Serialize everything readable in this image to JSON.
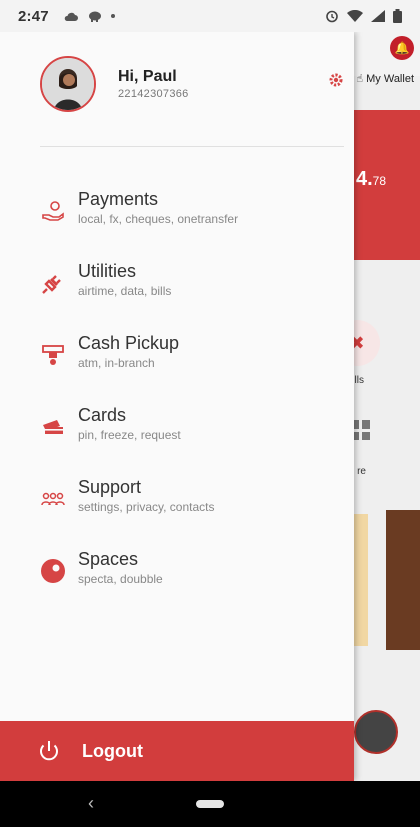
{
  "status_bar": {
    "time": "2:47"
  },
  "background": {
    "wallet_label": "My Wallet",
    "amount_main": "4.",
    "amount_decimal": "78",
    "bills_label": "lls",
    "more_label": "re"
  },
  "profile": {
    "greeting": "Hi, Paul",
    "account_number": "22142307366"
  },
  "menu": {
    "items": [
      {
        "title": "Payments",
        "subtitle": "local, fx, cheques, onetransfer",
        "icon": "hand-coin-icon"
      },
      {
        "title": "Utilities",
        "subtitle": "airtime, data, bills",
        "icon": "plug-icon"
      },
      {
        "title": "Cash Pickup",
        "subtitle": "atm, in-branch",
        "icon": "atm-icon"
      },
      {
        "title": "Cards",
        "subtitle": "pin, freeze, request",
        "icon": "cards-icon"
      },
      {
        "title": "Support",
        "subtitle": "settings, privacy, contacts",
        "icon": "people-icon"
      },
      {
        "title": "Spaces",
        "subtitle": "specta, doubble",
        "icon": "spaces-icon"
      }
    ]
  },
  "logout": {
    "label": "Logout"
  },
  "colors": {
    "accent": "#d23d3d",
    "icon_red": "#d64545"
  }
}
